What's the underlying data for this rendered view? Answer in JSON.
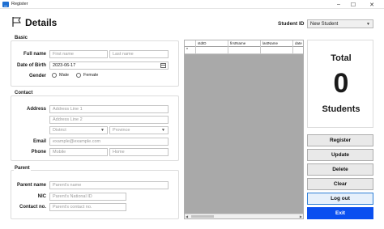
{
  "window": {
    "title": "Register"
  },
  "header": {
    "title": "Details"
  },
  "student_id": {
    "label": "Student ID",
    "selected": "New Student"
  },
  "basic": {
    "title": "Basic",
    "full_name_label": "Full name",
    "first_name_placeholder": "First name",
    "last_name_placeholder": "Last name",
    "dob_label": "Date of Birth",
    "dob_value": "2023-06-17",
    "gender_label": "Gender",
    "gender_options": [
      "Male",
      "Female"
    ]
  },
  "contact": {
    "title": "Contact",
    "address_label": "Address",
    "address1_placeholder": "Address Line 1",
    "address2_placeholder": "Address Line 2",
    "district_placeholder": "District",
    "province_placeholder": "Province",
    "email_label": "Email",
    "email_placeholder": "example@example.com",
    "phone_label": "Phone",
    "mobile_placeholder": "Mobile",
    "home_placeholder": "Home"
  },
  "parent": {
    "title": "Parent",
    "name_label": "Parent name",
    "name_placeholder": "Parent's name",
    "nic_label": "NIC",
    "nic_placeholder": "Parent's National ID",
    "contact_label": "Contact no.",
    "contact_placeholder": "Parent's contact no."
  },
  "grid": {
    "columns": [
      "",
      "stdID",
      "firstName",
      "lastName",
      "date"
    ],
    "new_row_marker": "*"
  },
  "summary": {
    "title": "Total",
    "count": "0",
    "subtitle": "Students"
  },
  "actions": {
    "register": "Register",
    "update": "Update",
    "delete": "Delete",
    "clear": "Clear",
    "logout": "Log out",
    "exit": "Exit"
  },
  "colors": {
    "exit_bg": "#0a4ff0",
    "logout_border": "#2f7fd6",
    "app_icon": "#1f6fd1"
  }
}
